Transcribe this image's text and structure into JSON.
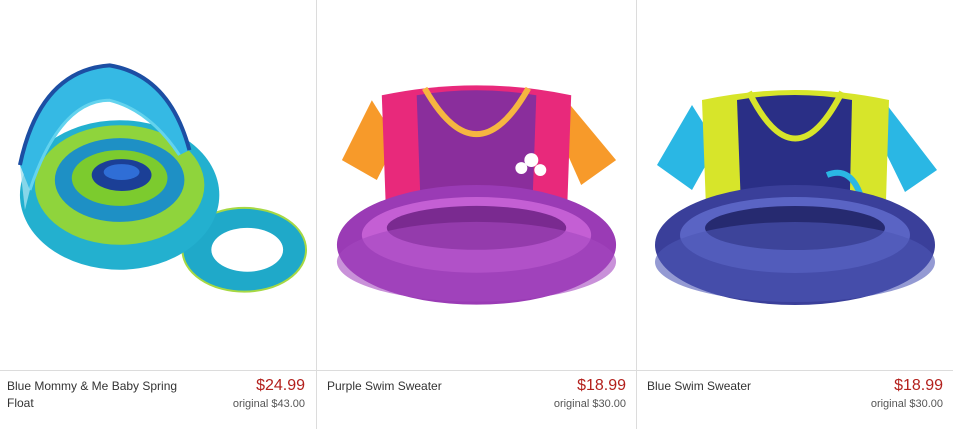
{
  "products": [
    {
      "name": "Blue Mommy & Me Baby Spring Float",
      "price": "$24.99",
      "original": "original $43.00"
    },
    {
      "name": "Purple Swim Sweater",
      "price": "$18.99",
      "original": "original $30.00"
    },
    {
      "name": "Blue Swim Sweater",
      "price": "$18.99",
      "original": "original $30.00"
    }
  ],
  "colors": {
    "price": "#b3201c",
    "divider": "#dcdcdc"
  }
}
